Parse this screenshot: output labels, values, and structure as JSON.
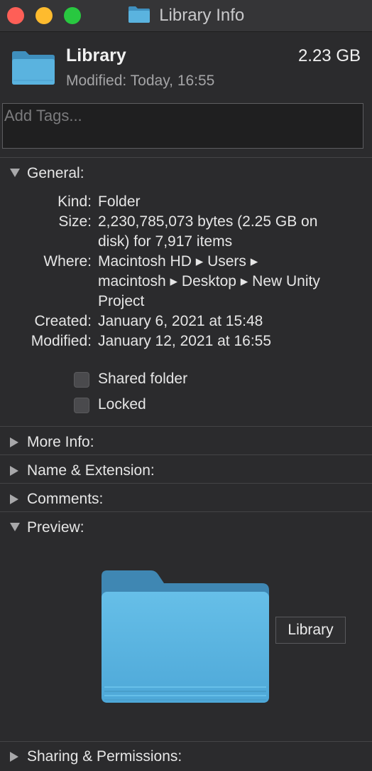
{
  "window": {
    "title": "Library Info"
  },
  "header": {
    "name": "Library",
    "size": "2.23 GB",
    "modified": "Modified: Today, 16:55"
  },
  "tags": {
    "placeholder": "Add Tags..."
  },
  "sections": {
    "general": "General:",
    "more_info": "More Info:",
    "name_extension": "Name & Extension:",
    "comments": "Comments:",
    "preview": "Preview:",
    "sharing": "Sharing & Permissions:"
  },
  "general": {
    "kind_label": "Kind:",
    "kind_value": "Folder",
    "size_label": "Size:",
    "size_value_1": "2,230,785,073 bytes (2.25 GB on",
    "size_value_2": "disk) for 7,917 items",
    "where_label": "Where:",
    "where_value_1": "Macintosh HD ▸ Users ▸",
    "where_value_2": "macintosh ▸ Desktop ▸ New Unity",
    "where_value_3": "Project",
    "created_label": "Created:",
    "created_value": "January 6, 2021 at 15:48",
    "modified_label": "Modified:",
    "modified_value": "January 12, 2021 at 16:55",
    "shared_folder": "Shared folder",
    "shared_folder_checked": false,
    "locked": "Locked",
    "locked_checked": false
  },
  "preview": {
    "tooltip": "Library"
  },
  "colors": {
    "background": "#2b2b2d",
    "folder_blue": "#5ab3df",
    "close": "#fe5f57",
    "minimize": "#febb2e",
    "maximize": "#28c840"
  },
  "icons": {
    "title": "folder-icon",
    "header": "folder-icon",
    "disclosure_open": "triangle-down-icon",
    "disclosure_closed": "triangle-right-icon"
  }
}
